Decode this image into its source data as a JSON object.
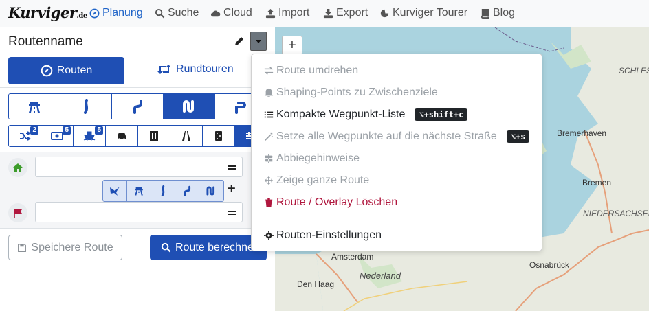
{
  "nav": {
    "logo": "Kurviger",
    "logo_suffix": ".de",
    "items": [
      {
        "label": "Planung",
        "icon": "compass-icon",
        "active": true
      },
      {
        "label": "Suche",
        "icon": "search-icon"
      },
      {
        "label": "Cloud",
        "icon": "cloud-icon"
      },
      {
        "label": "Import",
        "icon": "upload-icon"
      },
      {
        "label": "Export",
        "icon": "download-icon"
      },
      {
        "label": "Kurviger Tourer",
        "icon": "tourer-icon"
      },
      {
        "label": "Blog",
        "icon": "book-icon"
      }
    ]
  },
  "panel": {
    "route_name": "Routenname",
    "routen_label": "Routen",
    "rundtouren_label": "Rundtouren",
    "badges": {
      "shuffle": "2",
      "money": "5",
      "ferry": "5"
    },
    "start_value": "",
    "end_value": "",
    "save_label": "Speichere Route",
    "calc_label": "Route berechnen"
  },
  "dropdown": {
    "items": [
      {
        "label": "Route umdrehen",
        "icon": "swap-icon",
        "state": "disabled"
      },
      {
        "label": "Shaping-Points zu Zwischenziele",
        "icon": "bell-icon",
        "state": "disabled"
      },
      {
        "label": "Kompakte Wegpunkt-Liste",
        "icon": "list-icon",
        "state": "enabled",
        "shortcut": "⌥+shift+c"
      },
      {
        "label": "Setze alle Wegpunkte auf die nächste Straße",
        "icon": "magic-icon",
        "state": "disabled",
        "shortcut": "⌥+s"
      },
      {
        "label": "Abbiegehinweise",
        "icon": "signpost-icon",
        "state": "disabled"
      },
      {
        "label": "Zeige ganze Route",
        "icon": "arrows-icon",
        "state": "disabled"
      },
      {
        "label": "Route / Overlay Löschen",
        "icon": "trash-icon",
        "state": "danger"
      },
      {
        "label": "Routen-Einstellungen",
        "icon": "cog-icon",
        "state": "enabled"
      }
    ]
  },
  "map": {
    "zoom_in": "+",
    "labels": {
      "schleswig": "SCHLESW",
      "bremerhaven": "Bremerhaven",
      "bremen": "Bremen",
      "niedersachsen": "NIEDERSACHSEN",
      "amsterdam": "Amsterdam",
      "nederland": "Nederland",
      "osnabrueck": "Osnabrück",
      "denhaag": "Den Haag"
    }
  },
  "colors": {
    "primary": "#1f4fb4",
    "danger": "#b0173e",
    "start_green": "#3c9c2a",
    "end_red": "#b0173e"
  }
}
